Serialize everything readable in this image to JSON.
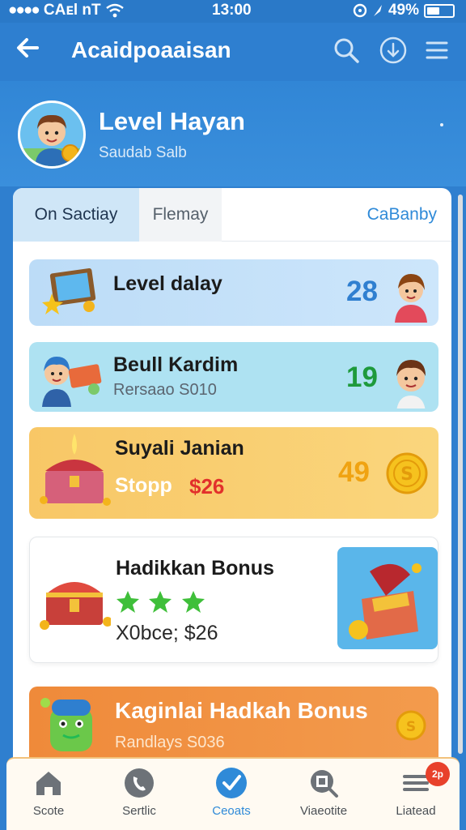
{
  "status_bar": {
    "carrier": "CAᴇl nT",
    "time": "13:00",
    "battery": "49%",
    "battery_level": 0.49
  },
  "app_bar": {
    "title": "Acaidpoaaisan",
    "back_icon": "arrow-left-icon",
    "actions": [
      "search-icon",
      "download-icon",
      "menu-icon"
    ]
  },
  "profile": {
    "name": "Level Hayan",
    "subtitle": "Saudab Salb"
  },
  "tabs": {
    "items": [
      {
        "label": "On Sactiay",
        "active": true
      },
      {
        "label": "Flemay",
        "active": false
      }
    ],
    "right_link": "CaBanby"
  },
  "list": [
    {
      "title": "Level dalay",
      "value": "28",
      "value_color": "#2f7fd0"
    },
    {
      "title": "Beull Kardim",
      "subtitle": "Rersaao S010",
      "value": "19",
      "value_color": "#1e9a3c"
    },
    {
      "title": "Suyali Janian",
      "subtitle": "Stopp",
      "price": "$26",
      "value": "49",
      "value_color": "#f0a312"
    },
    {
      "title": "Hadikkan Bonus",
      "subtitle": "X0bce; $26",
      "stars": 3
    },
    {
      "title": "Kaginlai Hadkah Bonus",
      "subtitle": "Randlays S036"
    }
  ],
  "bottom_nav": {
    "items": [
      {
        "label": "Scote",
        "icon": "home-icon"
      },
      {
        "label": "Sertlic",
        "icon": "phone-icon"
      },
      {
        "label": "Ceoats",
        "icon": "check-shield-icon",
        "active": true
      },
      {
        "label": "Viaeotite",
        "icon": "qr-search-icon"
      },
      {
        "label": "Liatead",
        "icon": "list-icon",
        "badge": "2p"
      }
    ]
  },
  "colors": {
    "primary": "#2f7fcf",
    "accent_blue": "#2f8ad8",
    "badge": "#e8412b"
  }
}
